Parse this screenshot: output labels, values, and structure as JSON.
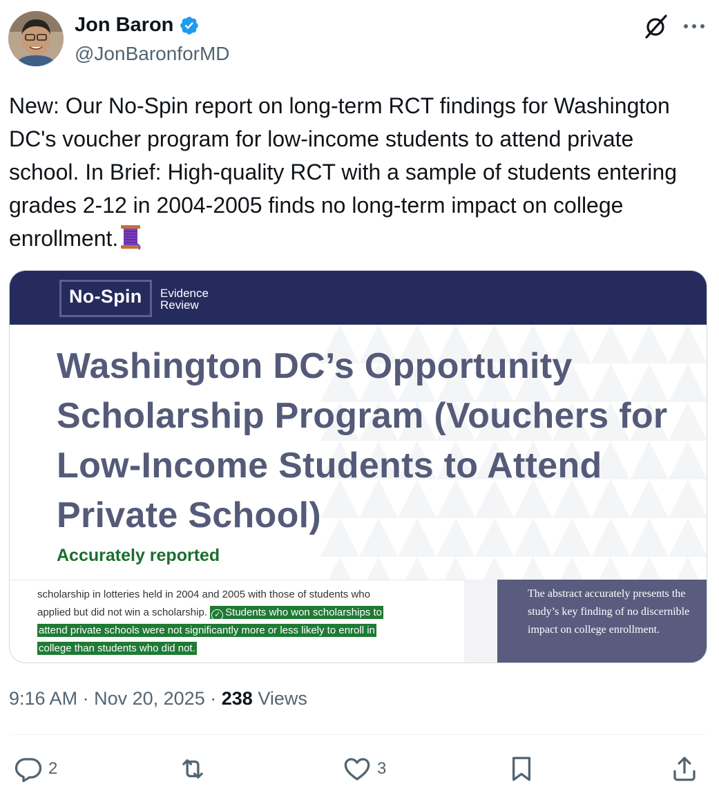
{
  "author": {
    "name": "Jon Baron",
    "handle": "@JonBaronforMD",
    "verified": true
  },
  "header_icons": [
    "grok-icon",
    "more-icon"
  ],
  "tweet_text": "New: Our No-Spin report on long-term RCT findings for Washington DC's voucher program for low-income students to attend private school. In Brief: High-quality RCT with a sample of students entering grades 2-12 in 2004-2005 finds no long-term impact on college enrollment.",
  "tweet_emoji": "spool-of-thread",
  "card": {
    "logo_main": "No-Spin",
    "logo_sub_1": "Evidence",
    "logo_sub_2": "Review",
    "title": "Washington DC’s Opportunity Scholarship Program (Vouchers for Low-Income Students to Attend Private School)",
    "verdict": "Accurately reported",
    "excerpt_line1": "scholarship in lotteries held in 2004 and 2005 with those of students who",
    "excerpt_line2_plain": "applied but did not win a scholarship.",
    "excerpt_line2_hl": "Students who won scholarships to",
    "excerpt_line3_hl": "attend private schools were not significantly more or less likely to enroll in",
    "excerpt_line4_hl": "college than students who did not.",
    "sidebox": "The abstract accurately presents the study’s key finding of no discernible impact on college enrollment.",
    "colors": {
      "header": "#262b5e",
      "title": "#545a78",
      "verdict": "#1b6e2c",
      "highlight": "#1f7a34",
      "sidebox": "#595c7e"
    }
  },
  "meta": {
    "time": "9:16 AM",
    "separator": "·",
    "date": "Nov 20, 2025",
    "views_count": "238",
    "views_label": "Views"
  },
  "actions": {
    "replies": "2",
    "reposts": "",
    "likes": "3"
  }
}
